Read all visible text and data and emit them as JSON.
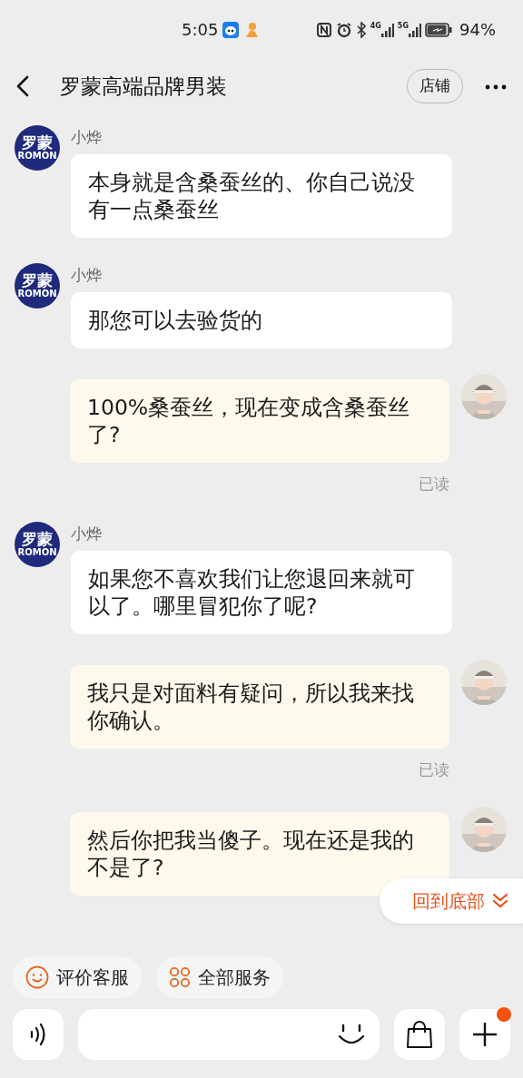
{
  "status_bar": {
    "time": "5:05",
    "network_labels": [
      "4G",
      "5G"
    ],
    "battery": "94%"
  },
  "header": {
    "title": "罗蒙高端品牌男装",
    "shop_button": "店铺"
  },
  "messages": [
    {
      "kind": "received",
      "sender": "小烨",
      "logo": [
        "罗蒙",
        "ROMON"
      ],
      "text": "本身就是含桑蚕丝的、你自己说没有一点桑蚕丝"
    },
    {
      "kind": "received",
      "sender": "小烨",
      "logo": [
        "罗蒙",
        "ROMON"
      ],
      "text": "那您可以去验货的"
    },
    {
      "kind": "sent",
      "text": "100%桑蚕丝，现在变成含桑蚕丝了?",
      "status": "已读"
    },
    {
      "kind": "received",
      "sender": "小烨",
      "logo": [
        "罗蒙",
        "ROMON"
      ],
      "text": "如果您不喜欢我们让您退回来就可以了。哪里冒犯你了呢?"
    },
    {
      "kind": "sent",
      "text": "我只是对面料有疑问，所以我来找你确认。",
      "status": "已读"
    },
    {
      "kind": "sent",
      "text": "然后你把我当傻子。现在还是我的不是了?"
    }
  ],
  "scroll_bottom_button": "回到底部",
  "quick_actions": [
    {
      "label": "评价客服"
    },
    {
      "label": "全部服务"
    }
  ],
  "input_bar": {
    "plus_notification": true
  }
}
